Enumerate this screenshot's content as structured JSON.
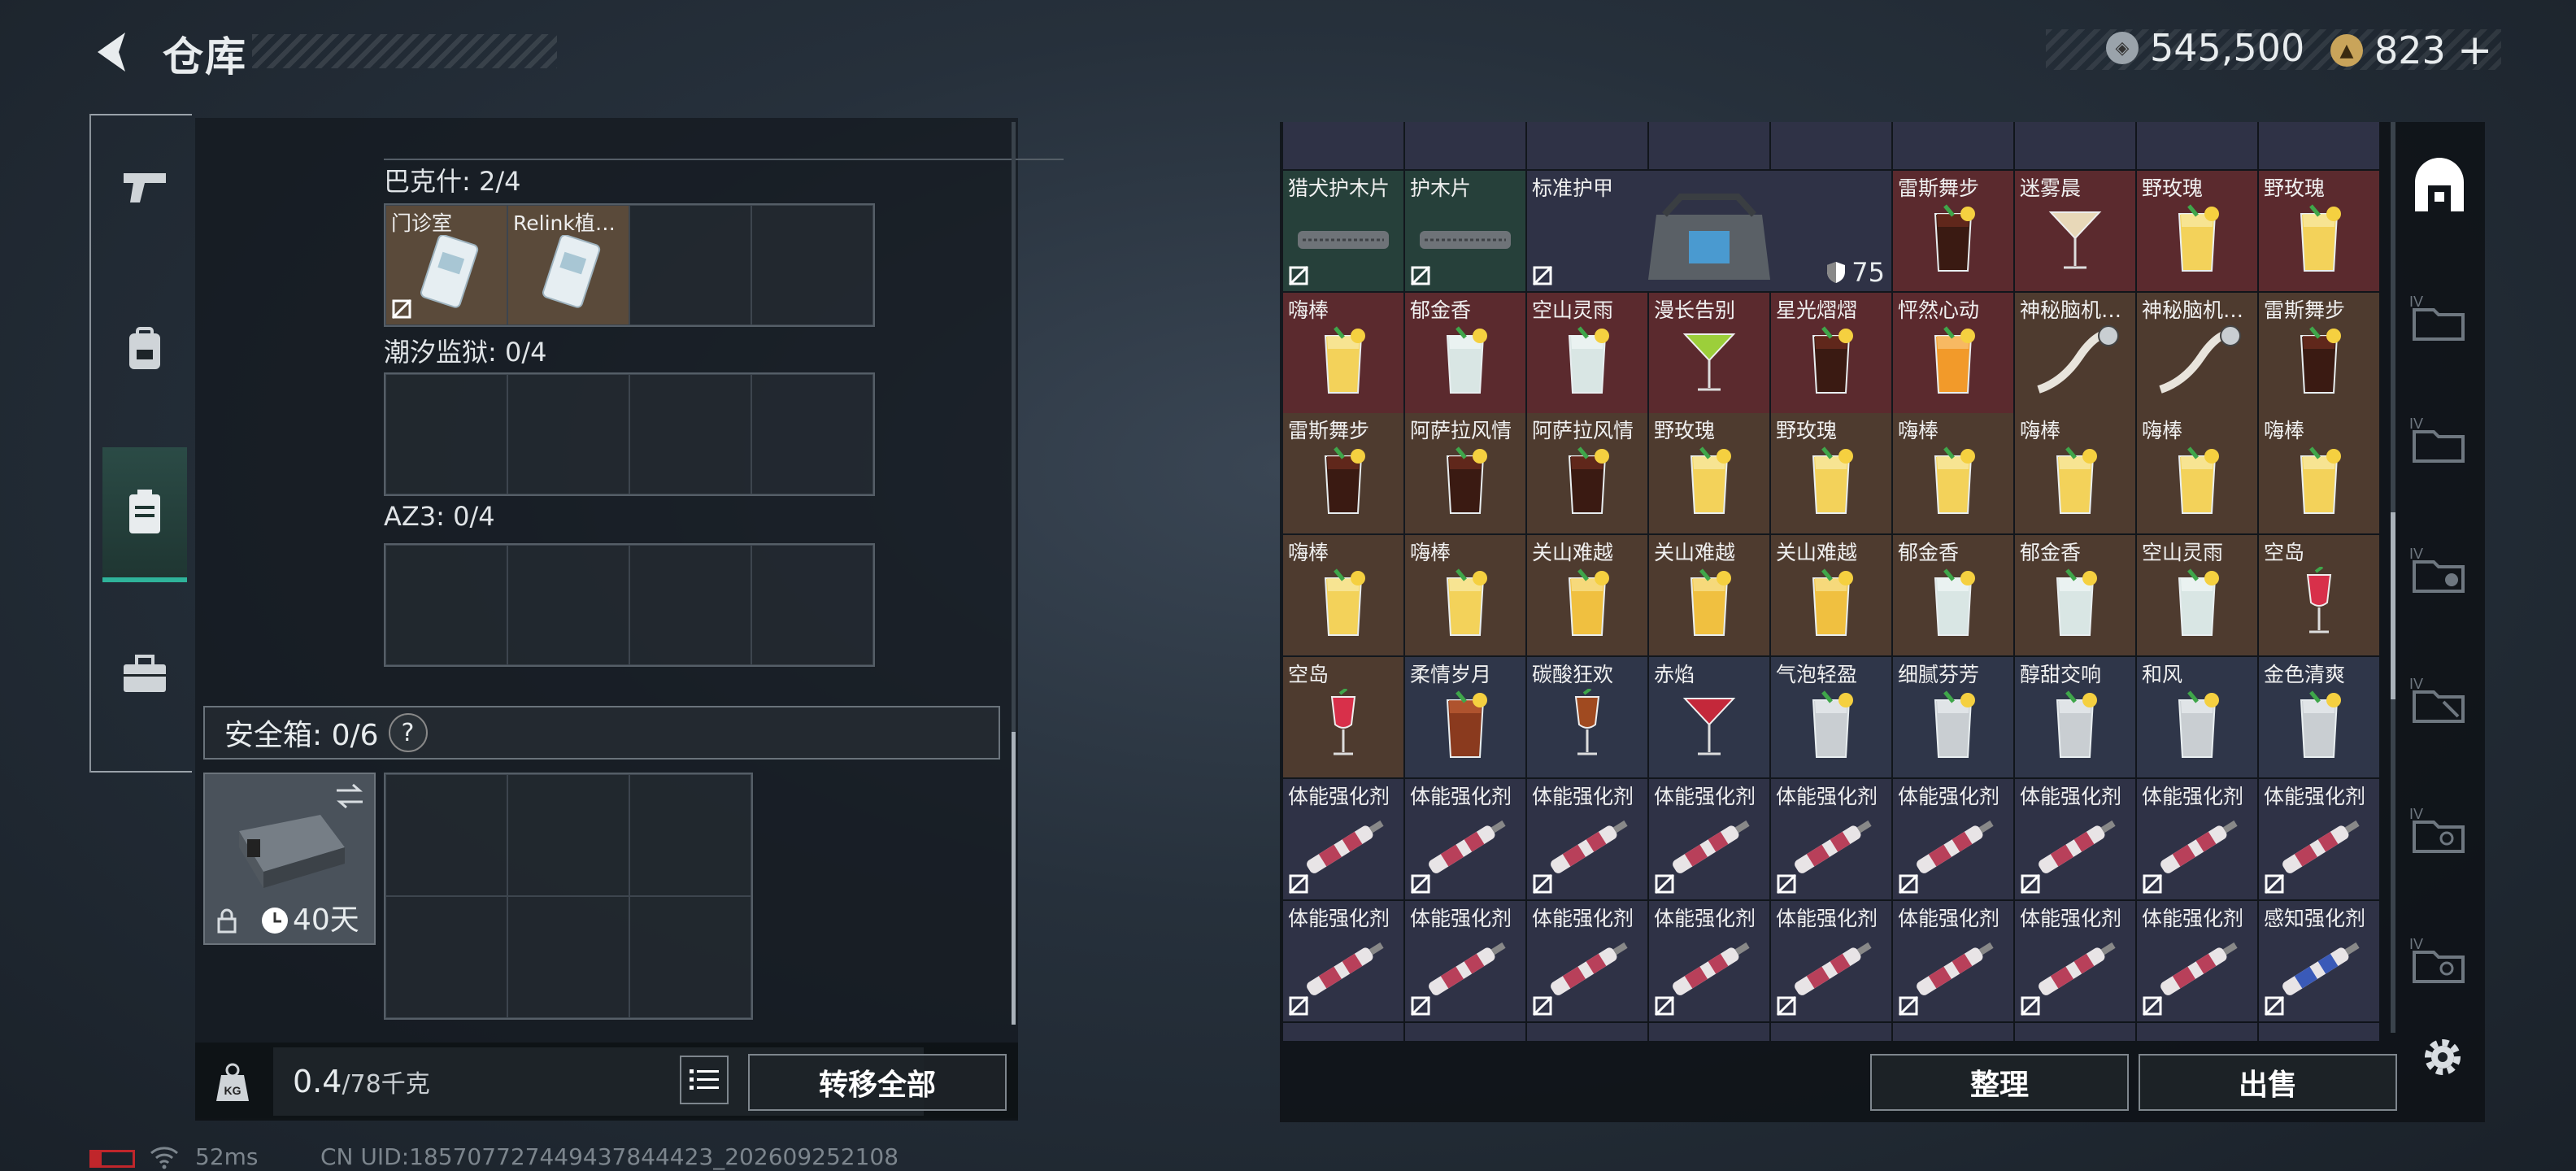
{
  "header": {
    "title": "仓库"
  },
  "currency": {
    "silver": "545,500",
    "gold": "823",
    "plus": "+"
  },
  "left": {
    "sections": [
      {
        "label": "巴克什: 2/4",
        "items": [
          "门诊室",
          "Relink植…"
        ]
      },
      {
        "label": "潮汐监狱: 0/4",
        "items": []
      },
      {
        "label": "AZ3: 0/4",
        "items": []
      }
    ],
    "safe": {
      "label": "安全箱: 0/6",
      "help": "?",
      "days": "40天"
    },
    "weight": {
      "value": "0.4",
      "max": "/78千克"
    },
    "transfer_all": "转移全部"
  },
  "right": {
    "rows": [
      [
        {
          "name": "猎犬护木片",
          "bg": "green",
          "img": "part",
          "lock": true
        },
        {
          "name": "护木片",
          "bg": "green",
          "img": "part",
          "lock": true
        },
        {
          "name": "标准护甲",
          "bg": "purple",
          "img": "armor",
          "lock": true,
          "wide": true,
          "armor_value": "75"
        },
        {
          "name": "雷斯舞步",
          "bg": "red",
          "img": "cola"
        },
        {
          "name": "迷雾晨",
          "bg": "red",
          "img": "coupe"
        },
        {
          "name": "野玫瑰",
          "bg": "red",
          "img": "lemon"
        },
        {
          "name": "野玫瑰",
          "bg": "red",
          "img": "lemon"
        }
      ],
      [
        {
          "name": "嗨棒",
          "bg": "red",
          "img": "lemon"
        },
        {
          "name": "郁金香",
          "bg": "red",
          "img": "mint"
        },
        {
          "name": "空山灵雨",
          "bg": "red",
          "img": "mint"
        },
        {
          "name": "漫长告别",
          "bg": "red",
          "img": "martini"
        },
        {
          "name": "星光熠熠",
          "bg": "red",
          "img": "cola"
        },
        {
          "name": "怦然心动",
          "bg": "red",
          "img": "orange"
        },
        {
          "name": "神秘脑机…",
          "bg": "brown",
          "img": "cable"
        },
        {
          "name": "神秘脑机…",
          "bg": "brown",
          "img": "cable"
        },
        {
          "name": "雷斯舞步",
          "bg": "brown",
          "img": "cola"
        }
      ],
      [
        {
          "name": "雷斯舞步",
          "bg": "brown",
          "img": "cola"
        },
        {
          "name": "阿萨拉风情",
          "bg": "brown",
          "img": "cola"
        },
        {
          "name": "阿萨拉风情",
          "bg": "brown",
          "img": "cola"
        },
        {
          "name": "野玫瑰",
          "bg": "brown",
          "img": "lemon"
        },
        {
          "name": "野玫瑰",
          "bg": "brown",
          "img": "lemon"
        },
        {
          "name": "嗨棒",
          "bg": "brown",
          "img": "lemon"
        },
        {
          "name": "嗨棒",
          "bg": "brown",
          "img": "lemon"
        },
        {
          "name": "嗨棒",
          "bg": "brown",
          "img": "lemon"
        },
        {
          "name": "嗨棒",
          "bg": "brown",
          "img": "lemon"
        }
      ],
      [
        {
          "name": "嗨棒",
          "bg": "brown",
          "img": "lemon"
        },
        {
          "name": "嗨棒",
          "bg": "brown",
          "img": "lemon"
        },
        {
          "name": "关山难越",
          "bg": "brown",
          "img": "gold"
        },
        {
          "name": "关山难越",
          "bg": "brown",
          "img": "gold"
        },
        {
          "name": "关山难越",
          "bg": "brown",
          "img": "gold"
        },
        {
          "name": "郁金香",
          "bg": "brown",
          "img": "mint"
        },
        {
          "name": "郁金香",
          "bg": "brown",
          "img": "mint"
        },
        {
          "name": "空山灵雨",
          "bg": "brown",
          "img": "mint"
        },
        {
          "name": "空岛",
          "bg": "brown",
          "img": "redwine"
        }
      ],
      [
        {
          "name": "空岛",
          "bg": "brown",
          "img": "redwine"
        },
        {
          "name": "柔情岁月",
          "bg": "blue",
          "img": "whisky"
        },
        {
          "name": "碳酸狂欢",
          "bg": "blue",
          "img": "flute"
        },
        {
          "name": "赤焰",
          "bg": "blue",
          "img": "martini-red"
        },
        {
          "name": "气泡轻盈",
          "bg": "blue",
          "img": "ice"
        },
        {
          "name": "细腻芬芳",
          "bg": "blue",
          "img": "ice"
        },
        {
          "name": "醇甜交响",
          "bg": "blue",
          "img": "ice"
        },
        {
          "name": "和风",
          "bg": "blue",
          "img": "ice"
        },
        {
          "name": "金色清爽",
          "bg": "blue",
          "img": "ice"
        }
      ],
      [
        {
          "name": "体能强化剂",
          "bg": "purple",
          "img": "syringe",
          "lock": true
        },
        {
          "name": "体能强化剂",
          "bg": "purple",
          "img": "syringe",
          "lock": true
        },
        {
          "name": "体能强化剂",
          "bg": "purple",
          "img": "syringe",
          "lock": true
        },
        {
          "name": "体能强化剂",
          "bg": "purple",
          "img": "syringe",
          "lock": true
        },
        {
          "name": "体能强化剂",
          "bg": "purple",
          "img": "syringe",
          "lock": true
        },
        {
          "name": "体能强化剂",
          "bg": "purple",
          "img": "syringe",
          "lock": true
        },
        {
          "name": "体能强化剂",
          "bg": "purple",
          "img": "syringe",
          "lock": true
        },
        {
          "name": "体能强化剂",
          "bg": "purple",
          "img": "syringe",
          "lock": true
        },
        {
          "name": "体能强化剂",
          "bg": "purple",
          "img": "syringe",
          "lock": true
        }
      ],
      [
        {
          "name": "体能强化剂",
          "bg": "purple",
          "img": "syringe",
          "lock": true
        },
        {
          "name": "体能强化剂",
          "bg": "purple",
          "img": "syringe",
          "lock": true
        },
        {
          "name": "体能强化剂",
          "bg": "purple",
          "img": "syringe",
          "lock": true
        },
        {
          "name": "体能强化剂",
          "bg": "purple",
          "img": "syringe",
          "lock": true
        },
        {
          "name": "体能强化剂",
          "bg": "purple",
          "img": "syringe",
          "lock": true
        },
        {
          "name": "体能强化剂",
          "bg": "purple",
          "img": "syringe",
          "lock": true
        },
        {
          "name": "体能强化剂",
          "bg": "purple",
          "img": "syringe",
          "lock": true
        },
        {
          "name": "体能强化剂",
          "bg": "purple",
          "img": "syringe",
          "lock": true
        },
        {
          "name": "感知强化剂",
          "bg": "purple",
          "img": "syringe-blue",
          "lock": true
        }
      ]
    ],
    "organize": "整理",
    "sell": "出售"
  },
  "status": {
    "ping": "52ms",
    "uid": "CN UID:1857077274494378444​23_202609252108"
  },
  "colors": {
    "accent": "#2fb39a",
    "panel": "#141a20",
    "red_cell": "#5b2a2e",
    "brown_cell": "#4e3b2f",
    "blue_cell": "#2f3649",
    "green_cell": "#26403a"
  }
}
